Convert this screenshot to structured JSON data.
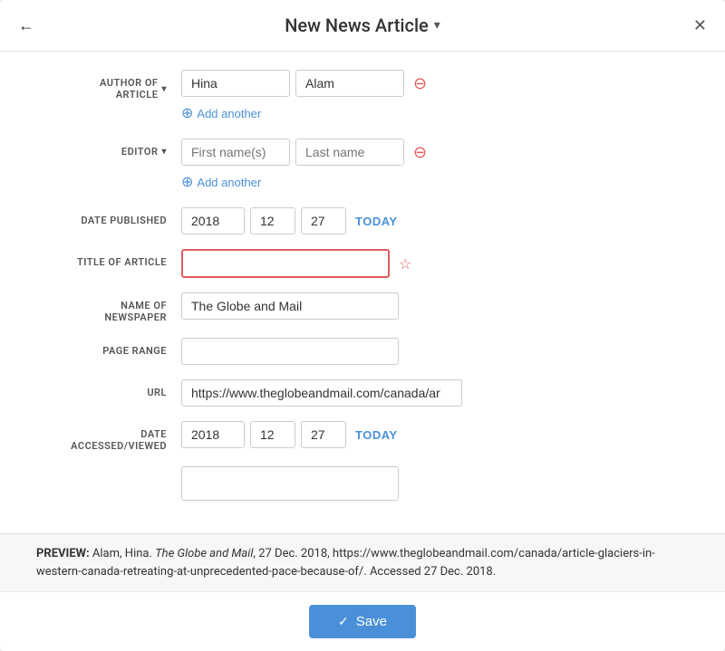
{
  "modal": {
    "title": "New News Article",
    "title_dropdown_arrow": "▾",
    "back_icon": "←",
    "close_icon": "✕"
  },
  "form": {
    "author_label": "AUTHOR OF\nARTICLE",
    "author_first_name": "Hina",
    "author_last_name": "Alam",
    "add_another_author": "Add another",
    "editor_label": "EDITOR",
    "editor_first_placeholder": "First name(s)",
    "editor_last_placeholder": "Last name",
    "add_another_editor": "Add another",
    "date_published_label": "DATE PUBLISHED",
    "date_published_year": "2018",
    "date_published_month": "12",
    "date_published_day": "27",
    "today_label": "TODAY",
    "title_of_article_label": "TITLE OF ARTICLE",
    "title_of_article_value": "",
    "name_of_newspaper_label": "NAME OF\nNEWSPAPER",
    "name_of_newspaper_value": "The Globe and Mail",
    "page_range_label": "PAGE RANGE",
    "page_range_value": "",
    "url_label": "URL",
    "url_value": "https://www.theglobeandmail.com/canada/ar",
    "date_accessed_label": "DATE\nACCESSED/VIEWED",
    "date_accessed_year": "2018",
    "date_accessed_month": "12",
    "date_accessed_day": "27",
    "today_accessed_label": "TODAY"
  },
  "preview": {
    "label": "PREVIEW:",
    "text_normal_1": "Alam, Hina. ",
    "text_italic": "The Globe and Mail",
    "text_normal_2": ", 27 Dec. 2018, https://www.theglobeandmail.com/canada/article-glaciers-in-western-canada-retreating-at-unprecedented-pace-because-of/. Accessed 27 Dec. 2018."
  },
  "footer": {
    "save_label": "Save",
    "save_icon": "✓"
  }
}
